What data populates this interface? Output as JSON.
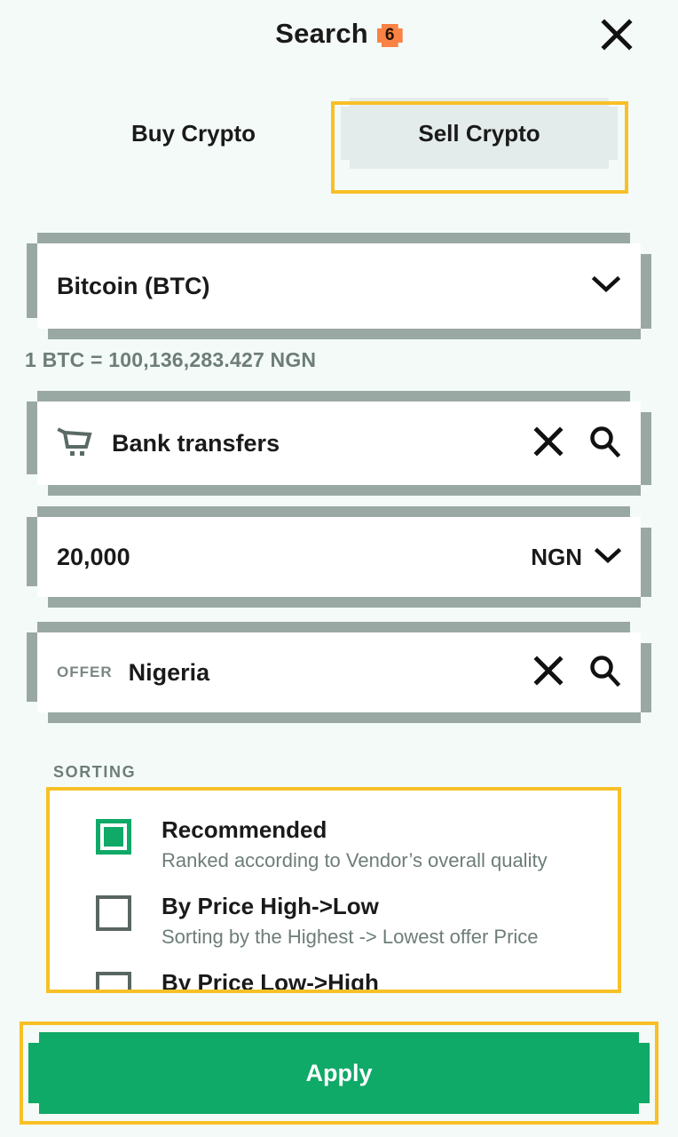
{
  "header": {
    "title": "Search",
    "badge_count": "6",
    "close_icon": "close-icon"
  },
  "tabs": [
    {
      "label": "Buy Crypto",
      "selected": false
    },
    {
      "label": "Sell Crypto",
      "selected": true
    }
  ],
  "fields": {
    "crypto": {
      "value": "Bitcoin (BTC)",
      "chevron_icon": "chevron-down-icon"
    },
    "rate_line": "1 BTC = 100,136,283.427 NGN",
    "payment_method": {
      "leading_icon": "cart-icon",
      "value": "Bank transfers",
      "clear_icon": "close-icon",
      "search_icon": "search-icon"
    },
    "amount": {
      "value": "20,000",
      "currency": "NGN",
      "chevron_icon": "chevron-down-icon"
    },
    "location": {
      "prefix_label": "OFFER",
      "value": "Nigeria",
      "clear_icon": "close-icon",
      "search_icon": "search-icon"
    }
  },
  "sorting": {
    "section_label": "SORTING",
    "options": [
      {
        "title": "Recommended",
        "description": "Ranked according to Vendor’s overall quality",
        "checked": true
      },
      {
        "title": "By Price High->Low",
        "description": "Sorting by the Highest -> Lowest offer Price",
        "checked": false
      },
      {
        "title": "By Price Low->High",
        "description": "",
        "checked": false
      }
    ]
  },
  "apply_button": {
    "label": "Apply"
  },
  "colors": {
    "page_background": "#f4faf7",
    "accent_green": "#0fa968",
    "annotation_yellow": "#f8c026",
    "badge_orange": "#f98244",
    "field_frame_gray": "#9aa8a3",
    "muted_text": "#6d7d77",
    "tab_selected_bg": "#e3ecea"
  }
}
